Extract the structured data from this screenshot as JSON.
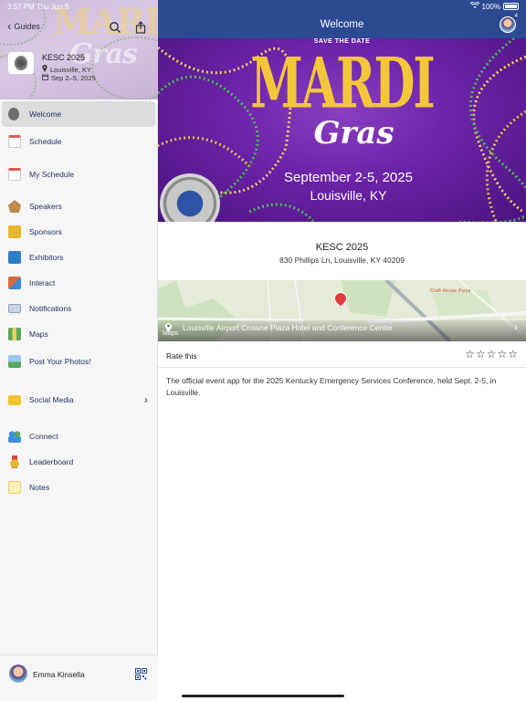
{
  "status": {
    "time": "3:57 PM",
    "day": "Thu Jun 5",
    "battery": "100%"
  },
  "sidebar": {
    "back_label": "Guides",
    "watermark": {
      "line1": "MARDI",
      "line2": "Gras"
    },
    "event": {
      "title": "KESC 2025",
      "location": "Louisville, KY",
      "dates": "Sep 2–5, 2025"
    },
    "items": [
      {
        "label": "Welcome",
        "icon": "badge-icon",
        "color": "#8c8c8c"
      },
      {
        "label": "Schedule",
        "icon": "calendar-icon",
        "color": "#e25a52"
      },
      {
        "label": "My Schedule",
        "icon": "my-schedule-icon",
        "color": "#e25a52"
      },
      {
        "label": "Speakers",
        "icon": "speaker-icon",
        "color": "#c08a4a"
      },
      {
        "label": "Sponsors",
        "icon": "sponsor-icon",
        "color": "#e8b62c"
      },
      {
        "label": "Exhibitors",
        "icon": "exhibitor-icon",
        "color": "#2f7fc8"
      },
      {
        "label": "Interact",
        "icon": "interact-icon",
        "color": "#d86a3a"
      },
      {
        "label": "Notifications",
        "icon": "envelope-icon",
        "color": "#8fa0b8"
      },
      {
        "label": "Maps",
        "icon": "map-icon",
        "color": "#5aa85a"
      },
      {
        "label": "Post Your Photos!",
        "icon": "photos-icon",
        "color": "#5a9ad8"
      },
      {
        "label": "Social Media",
        "icon": "folder-icon",
        "color": "#f0c431"
      },
      {
        "label": "Connect",
        "icon": "connect-icon",
        "color": "#3d8fd8"
      },
      {
        "label": "Leaderboard",
        "icon": "medal-icon",
        "color": "#e8b62c"
      },
      {
        "label": "Notes",
        "icon": "notes-icon",
        "color": "#f4e08a"
      }
    ],
    "user": {
      "name": "Emma Kinsella"
    }
  },
  "topbar": {
    "title": "Welcome",
    "badge": "4"
  },
  "banner": {
    "save_the_date": "SAVE THE DATE",
    "mardi": "MARDI",
    "gras": "Gras",
    "dates": "September 2-5, 2025",
    "location": "Louisville, KY"
  },
  "event": {
    "title": "KESC 2025",
    "address": "830 Phillips Ln, Louisville, KY 40209"
  },
  "map": {
    "venue": "Louisville Airport Crowne Plaza Hotel and Conference Center",
    "brand": "Maps",
    "poi": "Craft House Pizza"
  },
  "rating": {
    "label": "Rate this",
    "stars": 0,
    "max": 5
  },
  "description": "The official event app for the 2025 Kentucky Emergency Services Conference, held Sept. 2-5, in Louisville."
}
